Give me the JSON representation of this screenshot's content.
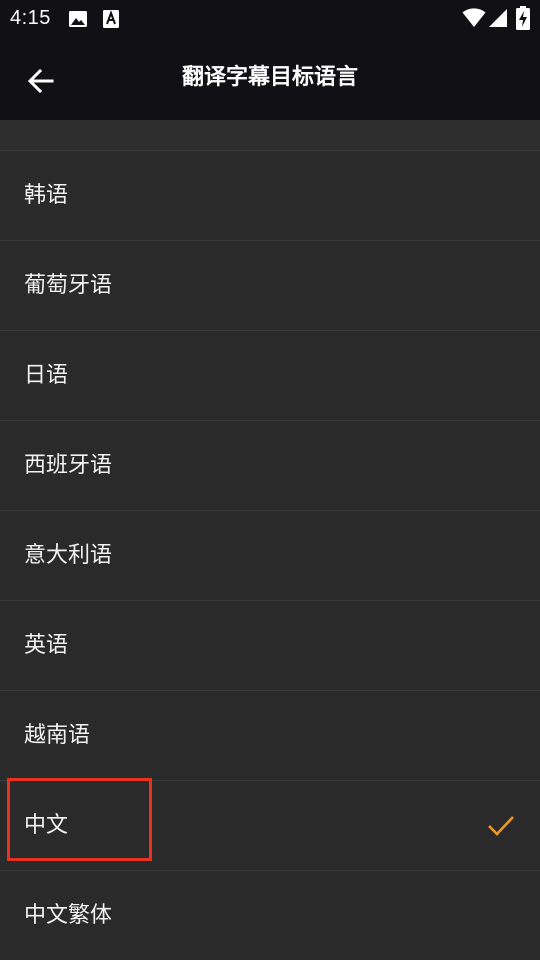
{
  "status_bar": {
    "time": "4:15",
    "icons": [
      "image-icon",
      "font-download-icon",
      "wifi-icon",
      "cellular-signal-icon",
      "battery-charging-icon"
    ]
  },
  "app_bar": {
    "back_icon": "arrow-left-icon",
    "title": "翻译字幕目标语言"
  },
  "languages": [
    {
      "label": "韩语",
      "selected": false
    },
    {
      "label": "葡萄牙语",
      "selected": false
    },
    {
      "label": "日语",
      "selected": false
    },
    {
      "label": "西班牙语",
      "selected": false
    },
    {
      "label": "意大利语",
      "selected": false
    },
    {
      "label": "英语",
      "selected": false
    },
    {
      "label": "越南语",
      "selected": false
    },
    {
      "label": "中文",
      "selected": true
    },
    {
      "label": "中文繁体",
      "selected": false
    }
  ],
  "colors": {
    "accent_check": "#f0962a",
    "highlight_box": "#e8321e",
    "app_bar_bg": "#111014",
    "list_bg": "#2a2a2b"
  }
}
